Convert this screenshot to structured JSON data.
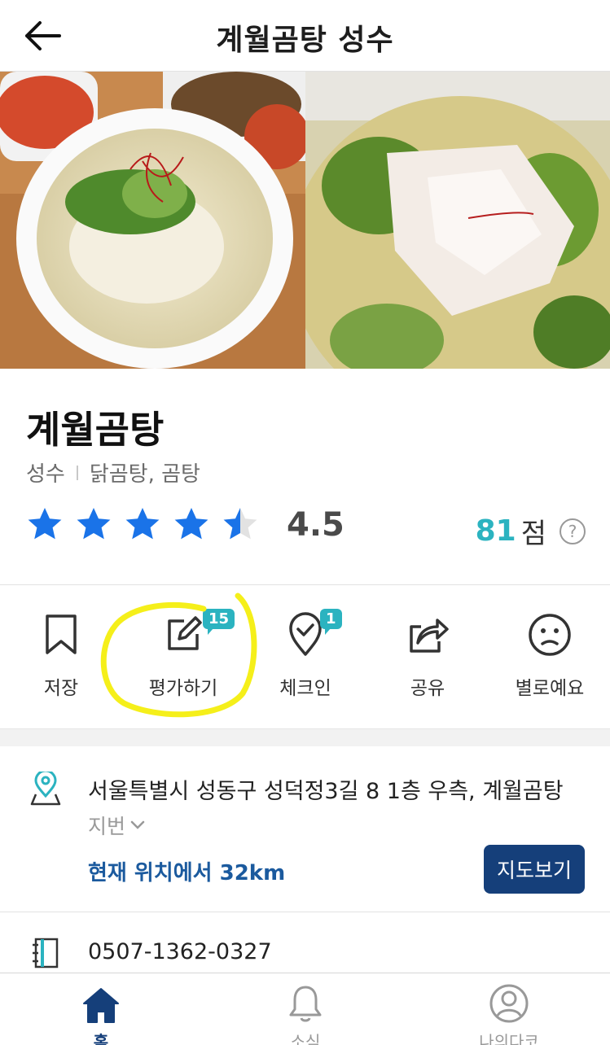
{
  "header": {
    "title": "계월곰탕 성수",
    "back_icon": "arrow-left-icon"
  },
  "restaurant": {
    "name": "계월곰탕",
    "area": "성수",
    "categories": "닭곰탕, 곰탕",
    "rating": "4.5",
    "rating_value": 4.5,
    "score_number": "81",
    "score_unit": "점",
    "help_label": "?"
  },
  "actions": {
    "save": {
      "label": "저장",
      "icon": "bookmark-icon"
    },
    "review": {
      "label": "평가하기",
      "icon": "edit-icon",
      "badge": "15"
    },
    "checkin": {
      "label": "체크인",
      "icon": "checkin-pin-icon",
      "badge": "1"
    },
    "share": {
      "label": "공유",
      "icon": "share-icon"
    },
    "meh": {
      "label": "별로예요",
      "icon": "meh-face-icon"
    }
  },
  "location": {
    "address": "서울특별시 성동구 성덕정3길 8 1층 우측, 계월곰탕",
    "jibun_label": "지번",
    "distance": "현재 위치에서 32km",
    "map_button": "지도보기"
  },
  "contact": {
    "phone": "0507-1362-0327"
  },
  "bottom_nav": {
    "home": "홈",
    "news": "소식",
    "my": "나의다코"
  },
  "colors": {
    "star": "#1a73e8",
    "accent_teal": "#2bb3c0",
    "primary_navy": "#153f7a",
    "highlight_yellow": "#f5ef1a"
  }
}
